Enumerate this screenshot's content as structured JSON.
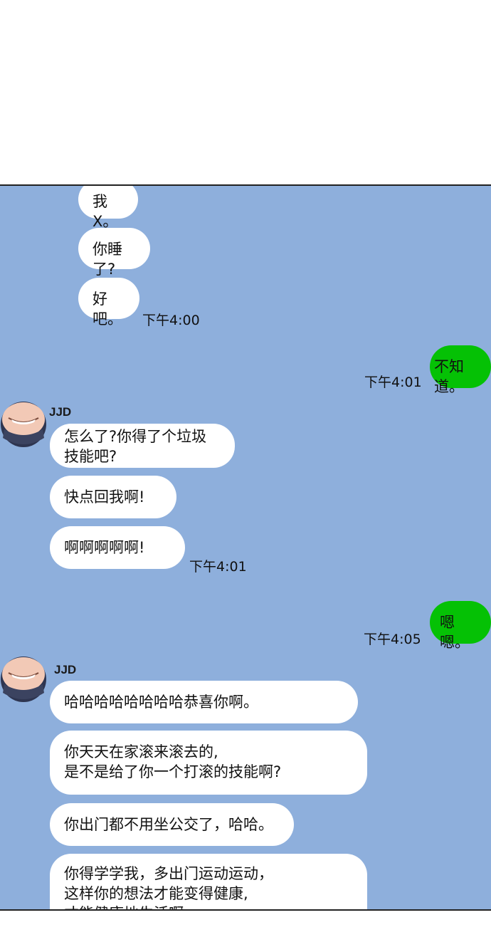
{
  "chat": {
    "colors": {
      "background": "#8eafdc",
      "incoming_bubble": "#ffffff",
      "outgoing_bubble": "#05c105"
    },
    "block1": {
      "messages": [
        "我X。",
        "你睡了?",
        "好吧。"
      ],
      "time": "下午4:00"
    },
    "reply1": {
      "text": "不知道。",
      "time": "下午4:01"
    },
    "block2": {
      "sender": "JJD",
      "messages": [
        "怎么了?你得了个垃圾\n技能吧?",
        "快点回我啊!",
        "啊啊啊啊啊!"
      ],
      "time": "下午4:01"
    },
    "reply2": {
      "text": "嗯嗯。",
      "time": "下午4:05"
    },
    "block3": {
      "sender": "JJD",
      "messages": [
        "哈哈哈哈哈哈哈哈恭喜你啊。",
        "你天天在家滚来滚去的,\n是不是给了你一个打滚的技能啊?",
        "你出门都不用坐公交了，哈哈。",
        "你得学学我，多出门运动运动，\n这样你的想法才能变得健康,\n才能健康地生活啊。"
      ]
    }
  }
}
